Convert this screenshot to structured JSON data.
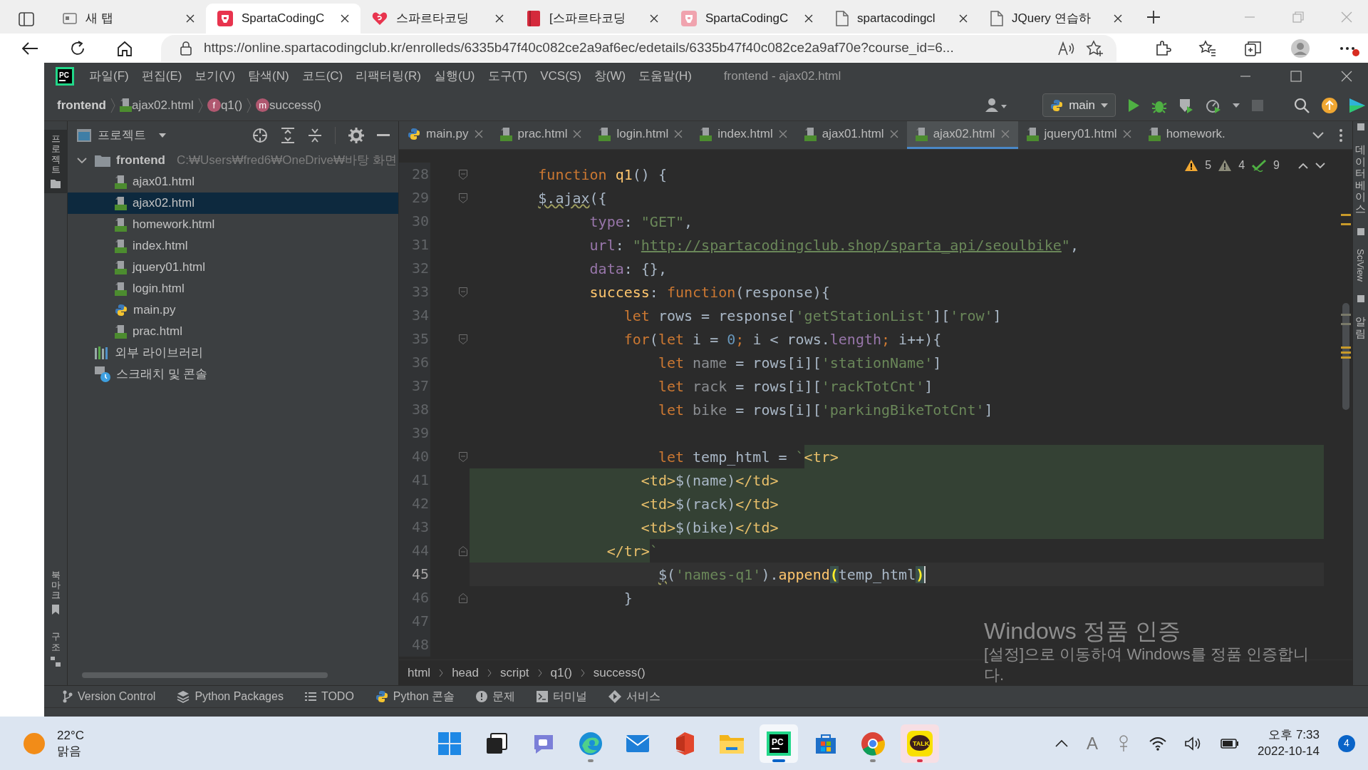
{
  "browser": {
    "tabs": [
      {
        "title": "새 탭",
        "kind": "window",
        "selected": false
      },
      {
        "title": "SpartaCodingC",
        "kind": "helmet",
        "selected": true
      },
      {
        "title": "스파르타코딩",
        "kind": "heart",
        "selected": false
      },
      {
        "title": "[스파르타코딩",
        "kind": "book",
        "selected": false
      },
      {
        "title": "SpartaCodingC",
        "kind": "helmet-light",
        "selected": false
      },
      {
        "title": "spartacodingcl",
        "kind": "document",
        "selected": false
      },
      {
        "title": "JQuery 연습하",
        "kind": "document",
        "selected": false
      }
    ],
    "url": "https://online.spartacodingclub.kr/enrolleds/6335b47f40c082ce2a9af6ec/edetails/6335b47f40c082ce2a9af70e?course_id=6..."
  },
  "ide": {
    "logo": "PC",
    "menu": [
      "파일(F)",
      "편집(E)",
      "보기(V)",
      "탐색(N)",
      "코드(C)",
      "리팩터링(R)",
      "실행(U)",
      "도구(T)",
      "VCS(S)",
      "창(W)",
      "도움말(H)"
    ],
    "title": "frontend - ajax02.html",
    "breadcrumbs": [
      {
        "kind": "project",
        "label": "frontend"
      },
      {
        "kind": "html",
        "label": "ajax02.html"
      },
      {
        "kind": "function",
        "badge": "f",
        "label": "q1()"
      },
      {
        "kind": "method",
        "badge": "m",
        "label": "success()"
      }
    ],
    "run_config": "main",
    "left_stripe": [
      {
        "label": "프로젝트",
        "selected": true
      },
      {
        "label": "북마크",
        "selected": false
      },
      {
        "label": "구조",
        "selected": false
      }
    ],
    "right_stripe": [
      {
        "kind": "vertical",
        "label": "데이터베이스"
      },
      {
        "kind": "rotated",
        "label": "SciView"
      },
      {
        "kind": "vertical",
        "label": "알림"
      }
    ],
    "project_panel": {
      "title": "프로젝트",
      "tree": [
        {
          "kind": "folder",
          "label": "frontend",
          "path": "C:₩Users₩fred6₩OneDrive₩바탕 화면",
          "expanded": true,
          "selected": false,
          "children": [
            {
              "kind": "html",
              "label": "ajax01.html",
              "selected": false
            },
            {
              "kind": "html",
              "label": "ajax02.html",
              "selected": true
            },
            {
              "kind": "html",
              "label": "homework.html",
              "selected": false
            },
            {
              "kind": "html",
              "label": "index.html",
              "selected": false
            },
            {
              "kind": "html",
              "label": "jquery01.html",
              "selected": false
            },
            {
              "kind": "html",
              "label": "login.html",
              "selected": false
            },
            {
              "kind": "python",
              "label": "main.py",
              "selected": false
            },
            {
              "kind": "html",
              "label": "prac.html",
              "selected": false
            }
          ]
        },
        {
          "kind": "library",
          "label": "외부 라이브러리",
          "expanded": false,
          "selected": false
        },
        {
          "kind": "scratch",
          "label": "스크래치 및 콘솔",
          "expanded": false,
          "selected": false
        }
      ]
    },
    "editor_tabs": [
      {
        "kind": "python",
        "label": "main.py",
        "selected": false,
        "closable": true
      },
      {
        "kind": "html",
        "label": "prac.html",
        "selected": false,
        "closable": true
      },
      {
        "kind": "html",
        "label": "login.html",
        "selected": false,
        "closable": true
      },
      {
        "kind": "html",
        "label": "index.html",
        "selected": false,
        "closable": true
      },
      {
        "kind": "html",
        "label": "ajax01.html",
        "selected": false,
        "closable": true
      },
      {
        "kind": "html",
        "label": "ajax02.html",
        "selected": true,
        "closable": true
      },
      {
        "kind": "html",
        "label": "jquery01.html",
        "selected": false,
        "closable": true
      },
      {
        "kind": "html",
        "label": "homework.",
        "selected": false,
        "closable": false
      }
    ],
    "inspections": [
      {
        "kind": "warning",
        "count": "5"
      },
      {
        "kind": "weak",
        "count": "4"
      },
      {
        "kind": "typo",
        "count": "9"
      }
    ],
    "code": [
      {
        "number": "28",
        "kind": "fold-start",
        "injected": false,
        "current": false,
        "tokens": [
          {
            "kind": "keyword",
            "text": "        function "
          },
          {
            "kind": "function",
            "text": "q1"
          },
          {
            "kind": "plain",
            "text": "() {"
          }
        ]
      },
      {
        "number": "29",
        "kind": "fold-start",
        "injected": false,
        "current": false,
        "tokens": [
          {
            "kind": "warn",
            "text": "        $.ajax"
          },
          {
            "kind": "plain",
            "text": "({"
          }
        ]
      },
      {
        "number": "30",
        "kind": "plain",
        "injected": false,
        "current": false,
        "tokens": [
          {
            "kind": "property",
            "text": "              type"
          },
          {
            "kind": "plain",
            "text": ": "
          },
          {
            "kind": "string",
            "text": "\"GET\""
          },
          {
            "kind": "plain",
            "text": ","
          }
        ]
      },
      {
        "number": "31",
        "kind": "plain",
        "injected": false,
        "current": false,
        "tokens": [
          {
            "kind": "property",
            "text": "              url"
          },
          {
            "kind": "plain",
            "text": ": "
          },
          {
            "kind": "string",
            "text": "\""
          },
          {
            "kind": "link",
            "text": "http://spartacodingclub.shop/sparta_api/seoulbike"
          },
          {
            "kind": "string",
            "text": "\""
          },
          {
            "kind": "plain",
            "text": ","
          }
        ]
      },
      {
        "number": "32",
        "kind": "plain",
        "injected": false,
        "current": false,
        "tokens": [
          {
            "kind": "property",
            "text": "              data"
          },
          {
            "kind": "plain",
            "text": ": {},"
          }
        ]
      },
      {
        "number": "33",
        "kind": "fold-start",
        "injected": false,
        "current": false,
        "tokens": [
          {
            "kind": "function",
            "text": "              success"
          },
          {
            "kind": "plain",
            "text": ": "
          },
          {
            "kind": "keyword",
            "text": "function"
          },
          {
            "kind": "plain",
            "text": "(response){"
          }
        ]
      },
      {
        "number": "34",
        "kind": "plain",
        "injected": false,
        "current": false,
        "tokens": [
          {
            "kind": "keyword",
            "text": "                  let"
          },
          {
            "kind": "plain",
            "text": " rows = response["
          },
          {
            "kind": "string",
            "text": "'getStationList'"
          },
          {
            "kind": "plain",
            "text": "]["
          },
          {
            "kind": "string",
            "text": "'row'"
          },
          {
            "kind": "plain",
            "text": "]"
          }
        ]
      },
      {
        "number": "35",
        "kind": "fold-start",
        "injected": false,
        "current": false,
        "tokens": [
          {
            "kind": "keyword",
            "text": "                  for"
          },
          {
            "kind": "plain",
            "text": "("
          },
          {
            "kind": "keyword",
            "text": "let"
          },
          {
            "kind": "plain",
            "text": " i = "
          },
          {
            "kind": "number",
            "text": "0"
          },
          {
            "kind": "keyword",
            "text": ";"
          },
          {
            "kind": "plain",
            "text": " i < rows."
          },
          {
            "kind": "property",
            "text": "length"
          },
          {
            "kind": "keyword",
            "text": ";"
          },
          {
            "kind": "plain",
            "text": " i++){"
          }
        ]
      },
      {
        "number": "36",
        "kind": "plain",
        "injected": false,
        "current": false,
        "tokens": [
          {
            "kind": "keyword",
            "text": "                      let "
          },
          {
            "kind": "dim",
            "text": "name"
          },
          {
            "kind": "plain",
            "text": " = rows[i]["
          },
          {
            "kind": "string",
            "text": "'stationName'"
          },
          {
            "kind": "plain",
            "text": "]"
          }
        ]
      },
      {
        "number": "37",
        "kind": "plain",
        "injected": false,
        "current": false,
        "tokens": [
          {
            "kind": "keyword",
            "text": "                      let "
          },
          {
            "kind": "dim",
            "text": "rack"
          },
          {
            "kind": "plain",
            "text": " = rows[i]["
          },
          {
            "kind": "string",
            "text": "'rackTotCnt'"
          },
          {
            "kind": "plain",
            "text": "]"
          }
        ]
      },
      {
        "number": "38",
        "kind": "plain",
        "injected": false,
        "current": false,
        "tokens": [
          {
            "kind": "keyword",
            "text": "                      let "
          },
          {
            "kind": "dim",
            "text": "bike"
          },
          {
            "kind": "plain",
            "text": " = rows[i]["
          },
          {
            "kind": "string",
            "text": "'parkingBikeTotCnt'"
          },
          {
            "kind": "plain",
            "text": "]"
          }
        ]
      },
      {
        "number": "39",
        "kind": "plain",
        "injected": false,
        "current": false
      },
      {
        "number": "40",
        "kind": "fold-start",
        "injected": true,
        "current": false,
        "tokens": [
          {
            "kind": "keyword",
            "text": "                      let"
          },
          {
            "kind": "plain",
            "text": " temp_html = "
          },
          {
            "kind": "string",
            "text": "`"
          },
          {
            "kind": "tag",
            "text": "<tr>"
          }
        ]
      },
      {
        "number": "41",
        "kind": "plain",
        "injected": true,
        "current": false,
        "tokens": [
          {
            "kind": "tag",
            "text": "                    <td>"
          },
          {
            "kind": "plain",
            "text": "$(name)"
          },
          {
            "kind": "tag",
            "text": "</td>"
          }
        ]
      },
      {
        "number": "42",
        "kind": "plain",
        "injected": true,
        "current": false,
        "tokens": [
          {
            "kind": "tag",
            "text": "                    <td>"
          },
          {
            "kind": "plain",
            "text": "$(rack)"
          },
          {
            "kind": "tag",
            "text": "</td>"
          }
        ]
      },
      {
        "number": "43",
        "kind": "plain",
        "injected": true,
        "current": false,
        "tokens": [
          {
            "kind": "tag",
            "text": "                    <td>"
          },
          {
            "kind": "plain",
            "text": "$(bike)"
          },
          {
            "kind": "tag",
            "text": "</td>"
          }
        ]
      },
      {
        "number": "44",
        "kind": "fold-end",
        "injected": true,
        "current": false,
        "tokens": [
          {
            "kind": "tag",
            "text": "                </tr>"
          },
          {
            "kind": "string",
            "text": "`"
          }
        ]
      },
      {
        "number": "45",
        "kind": "plain",
        "injected": false,
        "current": true,
        "tokens": [
          {
            "kind": "warn",
            "text": "                      $"
          },
          {
            "kind": "plain",
            "text": "("
          },
          {
            "kind": "string",
            "text": "'names-q1'"
          },
          {
            "kind": "plain",
            "text": ")."
          },
          {
            "kind": "function",
            "text": "append"
          },
          {
            "kind": "brace",
            "text": "("
          },
          {
            "kind": "plain",
            "text": "temp_html"
          },
          {
            "kind": "brace",
            "text": ")"
          }
        ]
      },
      {
        "number": "46",
        "kind": "fold-end",
        "injected": false,
        "current": false,
        "tokens": [
          {
            "kind": "plain",
            "text": "                  }"
          }
        ]
      },
      {
        "number": "47",
        "kind": "plain",
        "injected": false,
        "current": false
      },
      {
        "number": "48",
        "kind": "plain",
        "injected": false,
        "current": false
      }
    ],
    "footer_breadcrumbs": [
      "html",
      "head",
      "script",
      "q1()",
      "success()"
    ],
    "tool_tabs": [
      {
        "kind": "vcs",
        "label": "Version Control"
      },
      {
        "kind": "packages",
        "label": "Python Packages"
      },
      {
        "kind": "todo",
        "label": "TODO"
      },
      {
        "kind": "console",
        "label": "Python 콘솔"
      },
      {
        "kind": "problems",
        "label": "문제"
      },
      {
        "kind": "terminal",
        "label": "터미널"
      },
      {
        "kind": "services",
        "label": "서비스"
      }
    ]
  },
  "activation": {
    "title": "Windows 정품 인증",
    "message": "[설정]으로 이동하여 Windows를 정품 인증합니다."
  },
  "taskbar": {
    "weather": {
      "temperature": "22°C",
      "condition": "맑음"
    },
    "apps": [
      {
        "kind": "start",
        "running": false,
        "active": false,
        "attention": false
      },
      {
        "kind": "taskview",
        "running": false,
        "active": false,
        "attention": false
      },
      {
        "kind": "chat",
        "running": false,
        "active": false,
        "attention": false
      },
      {
        "kind": "edge",
        "running": true,
        "active": false,
        "attention": false
      },
      {
        "kind": "mail",
        "running": false,
        "active": false,
        "attention": false
      },
      {
        "kind": "office",
        "running": false,
        "active": false,
        "attention": false
      },
      {
        "kind": "explorer",
        "running": false,
        "active": false,
        "attention": false
      },
      {
        "kind": "pycharm",
        "label": "PC",
        "running": true,
        "active": true,
        "attention": false
      },
      {
        "kind": "store",
        "running": false,
        "active": false,
        "attention": false
      },
      {
        "kind": "chrome",
        "running": true,
        "active": false,
        "attention": false
      },
      {
        "kind": "kakao",
        "label": "TALK",
        "running": true,
        "active": false,
        "attention": true
      }
    ],
    "ime": "A",
    "time": "오후 7:33",
    "date": "2022-10-14",
    "notifications": "4"
  }
}
